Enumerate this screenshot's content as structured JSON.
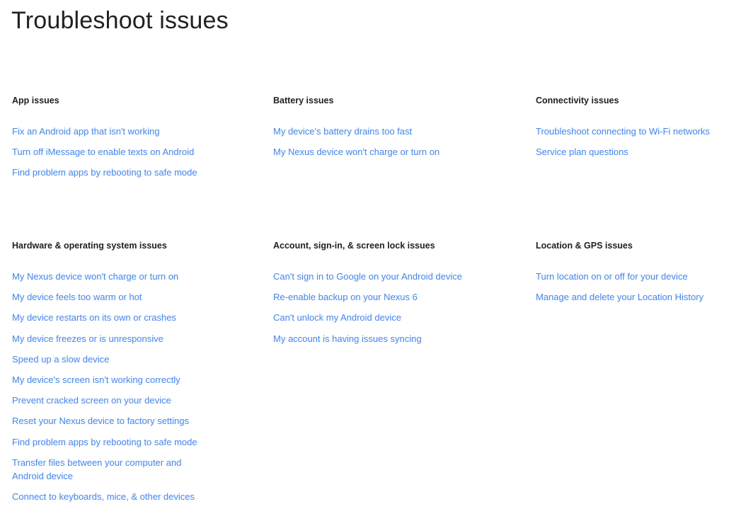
{
  "title": "Troubleshoot issues",
  "sections": {
    "app": {
      "heading": "App issues",
      "links": [
        "Fix an Android app that isn't working",
        "Turn off iMessage to enable texts on Android",
        "Find problem apps by rebooting to safe mode"
      ]
    },
    "battery": {
      "heading": "Battery issues",
      "links": [
        "My device's battery drains too fast",
        "My Nexus device won't charge or turn on"
      ]
    },
    "connectivity": {
      "heading": "Connectivity issues",
      "links": [
        "Troubleshoot connecting to Wi-Fi networks",
        "Service plan questions"
      ]
    },
    "hardware": {
      "heading": "Hardware & operating system issues",
      "links": [
        "My Nexus device won't charge or turn on",
        "My device feels too warm or hot",
        "My device restarts on its own or crashes",
        "My device freezes or is unresponsive",
        "Speed up a slow device",
        "My device's screen isn't working correctly",
        "Prevent cracked screen on your device",
        "Reset your Nexus device to factory settings",
        "Find problem apps by rebooting to safe mode",
        "Transfer files between your computer and Android device",
        "Connect to keyboards, mice, & other devices"
      ]
    },
    "account": {
      "heading": "Account, sign-in, & screen lock issues",
      "links": [
        "Can't sign in to Google on your Android device",
        "Re-enable backup on your Nexus 6",
        "Can't unlock my Android device",
        "My account is having issues syncing"
      ]
    },
    "location": {
      "heading": "Location & GPS issues",
      "links": [
        "Turn location on or off for your device",
        "Manage and delete your Location History"
      ]
    }
  },
  "colors": {
    "link": "#4285f4",
    "heading": "#212121"
  }
}
